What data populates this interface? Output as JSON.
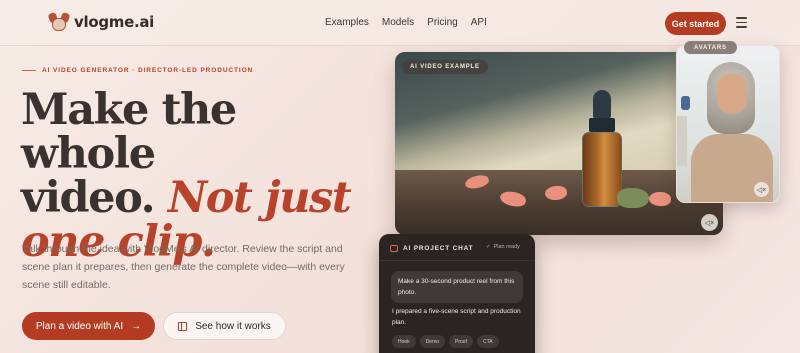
{
  "header": {
    "logo_text": "vlogme.ai",
    "nav": [
      "Examples",
      "Models",
      "Pricing",
      "API"
    ],
    "cta_label": "Get started"
  },
  "hero": {
    "eyebrow": "AI VIDEO GENERATOR · DIRECTOR-LED PRODUCTION",
    "headline_line1": "Make the whole",
    "headline_line2_plain": "video. ",
    "headline_line2_accent": "Not just",
    "headline_line3_accent": "one clip.",
    "subtext": "Talk through the idea with VlogMe's AI director. Review the script and scene plan it prepares, then generate the complete video—with every scene still editable.",
    "primary_button": "Plan a video with AI",
    "primary_arrow": "→",
    "secondary_button": "See how it works"
  },
  "video": {
    "badge": "AI VIDEO EXAMPLE",
    "mute_icon": "speaker-muted-icon"
  },
  "avatar": {
    "badge": "AVATARS"
  },
  "chat": {
    "title": "AI PROJECT CHAT",
    "status": "Plan ready",
    "status_check": "✓",
    "user_message": "Make a 30-second product reel from this photo.",
    "bot_message": "I prepared a five-scene script and production plan.",
    "chips": [
      "Hook",
      "Demo",
      "Proof",
      "CTA"
    ]
  },
  "colors": {
    "accent": "#b43c22",
    "background": "#f6e8e3",
    "chat_bg": "#2a2523"
  }
}
